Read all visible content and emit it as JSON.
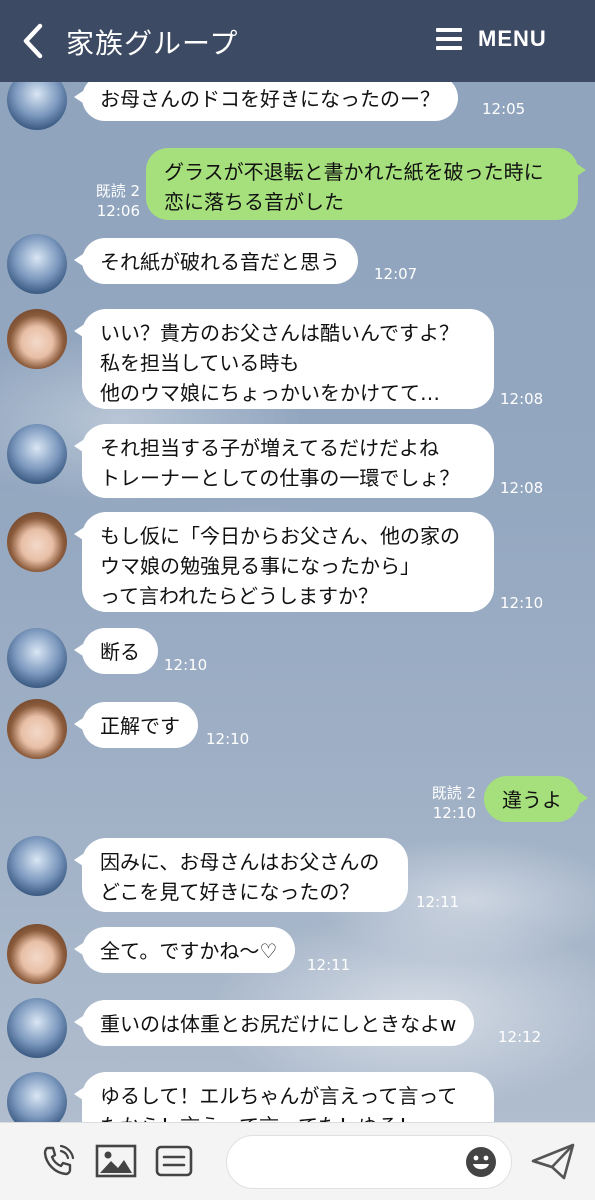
{
  "header": {
    "title": "家族グループ",
    "menu_label": "MENU"
  },
  "messages": [
    {
      "text": "お母さんのドコを好きになったのー？",
      "time": "12:05"
    },
    {
      "text": "グラスが不退転と書かれた紙を破った時に\n恋に落ちる音がした",
      "time": "12:06",
      "read": "既読 2"
    },
    {
      "text": "それ紙が破れる音だと思う",
      "time": "12:07"
    },
    {
      "text": "いい？貴方のお父さんは酷いんですよ？\n私を担当している時も\n他のウマ娘にちょっかいをかけてて…",
      "time": "12:08"
    },
    {
      "text": "それ担当する子が増えてるだけだよね\nトレーナーとしての仕事の一環でしょ？",
      "time": "12:08"
    },
    {
      "text": "もし仮に「今日からお父さん、他の家の\nウマ娘の勉強見る事になったから」\nって言われたらどうしますか？",
      "time": "12:10"
    },
    {
      "text": "断る",
      "time": "12:10"
    },
    {
      "text": "正解です",
      "time": "12:10"
    },
    {
      "text": "違うよ",
      "time": "12:10",
      "read": "既読 2"
    },
    {
      "text": "因みに、お母さんはお父さんの\nどこを見て好きになったの？",
      "time": "12:11"
    },
    {
      "text": "全て。ですかね〜♡",
      "time": "12:11"
    },
    {
      "text": "重いのは体重とお尻だけにしときなよw",
      "time": "12:12"
    },
    {
      "text": "ゆるして！エルちゃんが言えって言って\nたから！言えって言ってた！ゆる！",
      "time": ""
    }
  ],
  "footer": {
    "input_placeholder": ""
  },
  "colors": {
    "header_bg": "#3d4a63",
    "sent_bubble": "#a6e07c",
    "received_bubble": "#ffffff"
  }
}
